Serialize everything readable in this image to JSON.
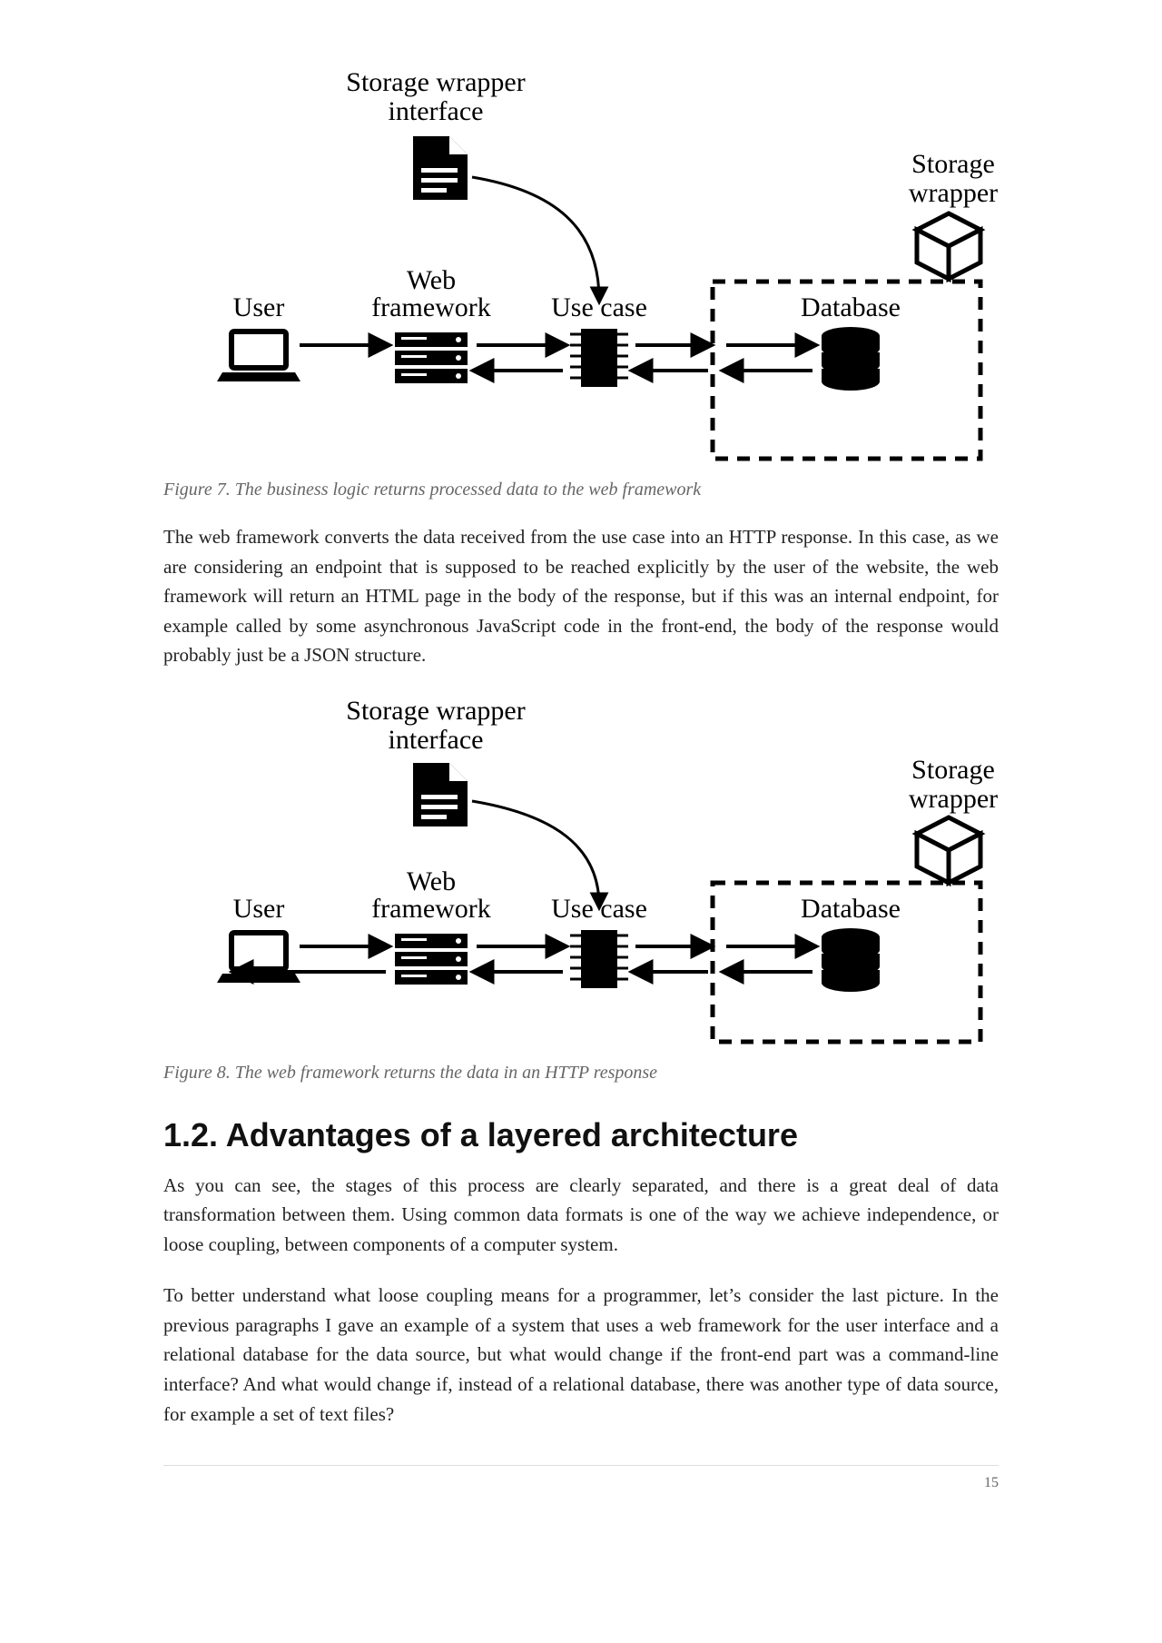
{
  "figures": {
    "fig7": {
      "caption": "Figure 7. The business logic returns processed data to the web framework",
      "labels": {
        "storage_wrapper_interface_l1": "Storage wrapper",
        "storage_wrapper_interface_l2": "interface",
        "storage_wrapper_l1": "Storage",
        "storage_wrapper_l2": "wrapper",
        "user": "User",
        "web_framework_l1": "Web",
        "web_framework_l2": "framework",
        "use_case": "Use case",
        "database": "Database"
      }
    },
    "fig8": {
      "caption": "Figure 8. The web framework returns the data in an HTTP response",
      "labels": {
        "storage_wrapper_interface_l1": "Storage wrapper",
        "storage_wrapper_interface_l2": "interface",
        "storage_wrapper_l1": "Storage",
        "storage_wrapper_l2": "wrapper",
        "user": "User",
        "web_framework_l1": "Web",
        "web_framework_l2": "framework",
        "use_case": "Use case",
        "database": "Database"
      }
    }
  },
  "paragraphs": {
    "p1": "The web framework converts the data received from the use case into an HTTP response. In this case, as we are considering an endpoint that is supposed to be reached explicitly by the user of the website, the web framework will return an HTML page in the body of the response, but if this was an internal endpoint, for example called by some asynchronous JavaScript code in the front-end, the body of the response would probably just be a JSON structure."
  },
  "section": {
    "heading": "1.2. Advantages of a layered architecture",
    "p2": "As you can see, the stages of this process are clearly separated, and there is a great deal of data transformation between them. Using common data formats is one of the way we achieve independence, or loose coupling, between components of a computer system.",
    "p3": "To better understand what loose coupling means for a programmer, let’s consider the last picture. In the previous paragraphs I gave an example of a system that uses a web framework for the user interface and a relational database for the data source, but what would change if the front-end part was a command-line interface? And what would change if, instead of a relational database, there was another type of data source, for example a set of text files?"
  },
  "page_number": "15"
}
